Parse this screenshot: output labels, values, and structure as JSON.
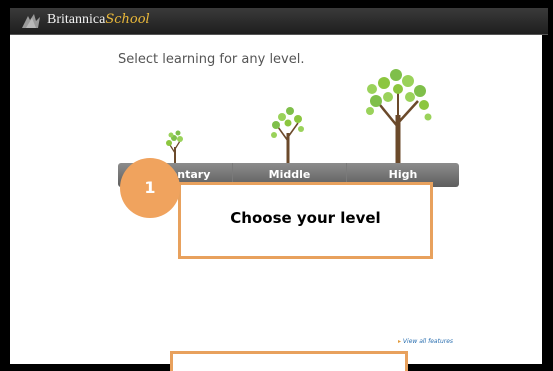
{
  "header": {
    "brand": "Britannica",
    "brand_school": "School"
  },
  "main": {
    "heading": "Select learning for any level.",
    "levels": [
      {
        "label": "Elementary"
      },
      {
        "label": "Middle"
      },
      {
        "label": "High"
      }
    ],
    "view_all_link": "View all features"
  },
  "callout": {
    "step_number": "1",
    "text": "Choose your level"
  },
  "colors": {
    "accent_orange": "#f0a35e",
    "level_bar": "#6f6f6f",
    "link_blue": "#2a6fb0",
    "tree_trunk": "#6b4a2b",
    "tree_leaf": "#7fbf4a"
  }
}
